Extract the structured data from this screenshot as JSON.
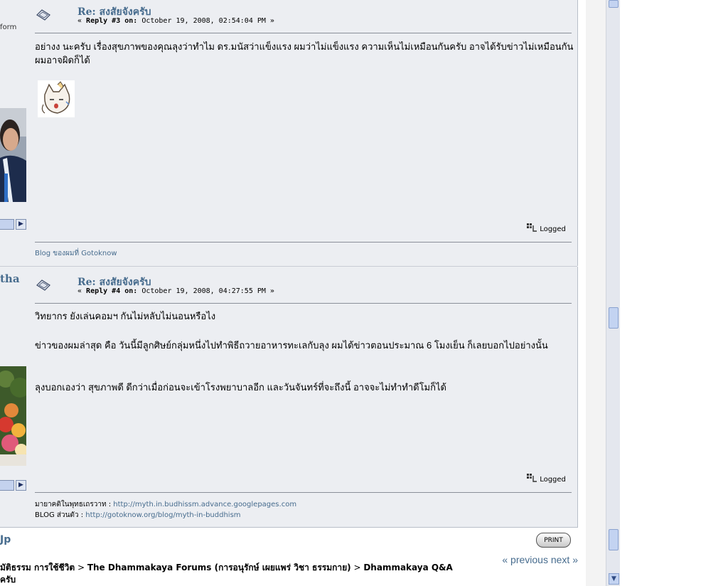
{
  "sidebar_fragments": {
    "top_text": "form",
    "user2_name": "tha"
  },
  "posts": [
    {
      "title": "Re: สงสัยจังครับ",
      "meta_prefix": "« ",
      "meta_reply": "Reply #3 on:",
      "meta_date": " October 19, 2008, 02:54:04 PM »",
      "paragraphs": [
        "อย่างง นะครับ เรื่องสุขภาพของคุณลุงว่าทำไม ดร.มนัสว่าแข็งแรง ผมว่าไม่แข็งแรง ความเห็นไม่เหมือนกันครับ อาจได้รับข่าวไม่เหมือนกัน ผมอาจผิดก็ได้"
      ],
      "logged": "Logged",
      "signature": [
        {
          "label": "",
          "text": "Blog ของผมที่ Gotoknow"
        }
      ]
    },
    {
      "title": "Re: สงสัยจังครับ",
      "meta_prefix": "« ",
      "meta_reply": "Reply #4 on:",
      "meta_date": " October 19, 2008, 04:27:55 PM »",
      "paragraphs": [
        "วิทยากร ยังเล่นคอมฯ กันไม่หลับไม่นอนหรือไง",
        "ข่าวของผมล่าสุด คือ วันนี้มีลูกศิษย์กลุ่มหนึ่งไปทำพิธีถวายอาหารทะเลกับลุง  ผมได้ข่าวตอนประมาณ 6 โมงเย็น   ก็เลยบอกไปอย่างนั้น",
        "ลุงบอกเองว่า สุขภาพดี ดีกว่าเมื่อก่อนจะเข้าโรงพยาบาลอีก และวันจันทร์ที่จะถึงนี้ อาจจะไม่ทำทำดีโมก็ได้"
      ],
      "logged": "Logged",
      "signature": [
        {
          "label": "มายาคติในพุทธเถรวาท : ",
          "text": "http://myth.in.budhissm.advance.googlepages.com"
        },
        {
          "label": "BLOG ส่วนตัว : ",
          "text": "http://gotoknow.org/blog/myth-in-buddhism"
        }
      ]
    }
  ],
  "footer": {
    "up_fragment": "Jp",
    "print_label": "PRINT",
    "prev_label": "« previous",
    "next_label": "next »",
    "breadcrumb_first": "มัติธรรม การใช้ชีวิต",
    "breadcrumb_sep": " > ",
    "breadcrumb_second": "The Dhammakaya Forums (การอนุรักษ์ เผยแพร่ วิชา ธรรมกาย)",
    "breadcrumb_third": "Dhammakaya Q&A",
    "breadcrumb_line2": "ครับ"
  },
  "colors": {
    "post_bg": "#eceef2",
    "link": "#476c8e",
    "scroll_thumb": "#c3d3f1"
  }
}
